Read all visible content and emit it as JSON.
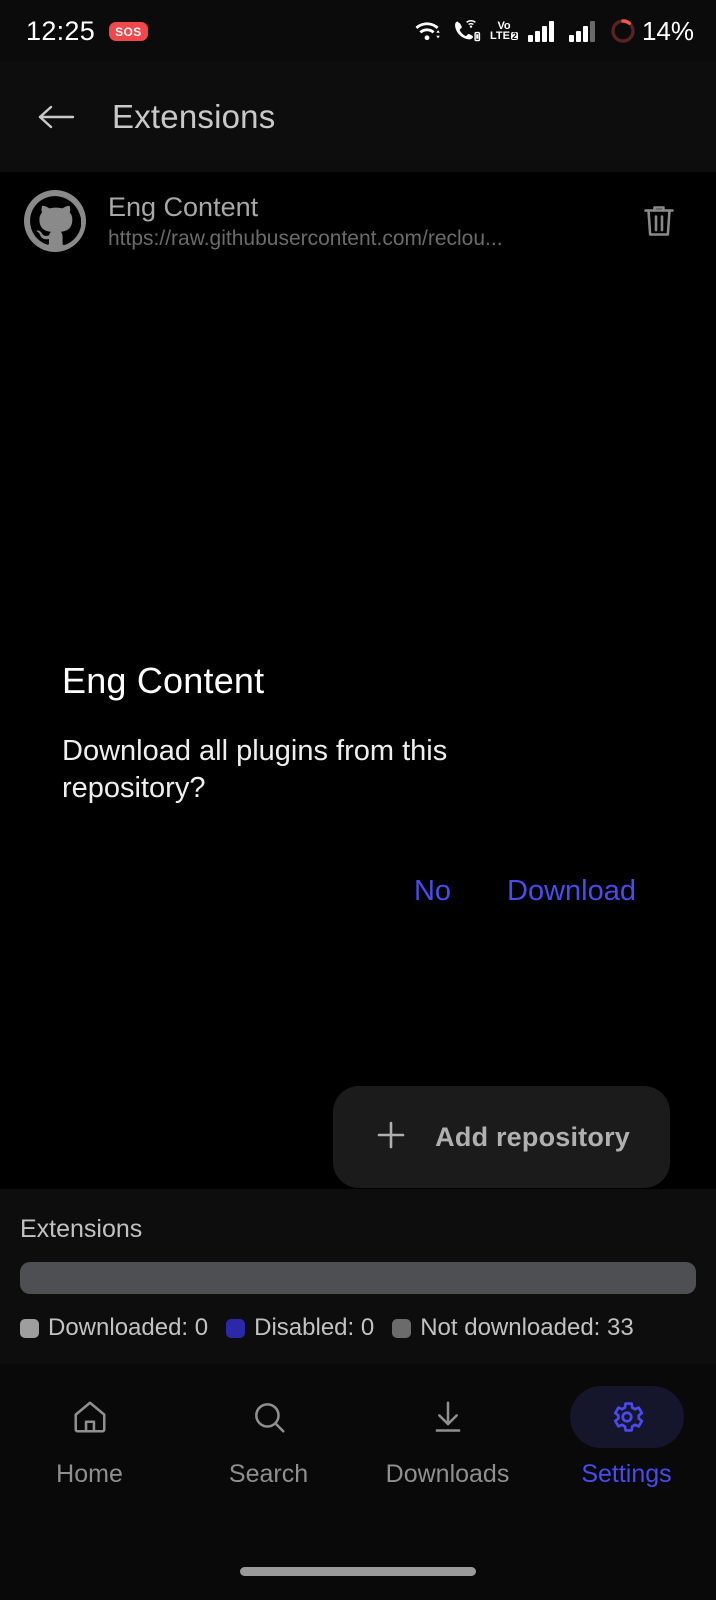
{
  "status_bar": {
    "time": "12:25",
    "sos_label": "SOS",
    "volte_top": "Vo",
    "volte_bottom": "LTE",
    "volte_sim": "2",
    "battery_percent": "14%",
    "icons": [
      "wifi-icon",
      "wifi-calling-icon",
      "volte-icon",
      "signal-bars-icon",
      "signal-bars-icon",
      "battery-ring-icon"
    ]
  },
  "app_bar": {
    "back_icon": "back-arrow-icon",
    "title": "Extensions"
  },
  "repository": {
    "avatar_icon": "github-icon",
    "name": "Eng Content",
    "url": "https://raw.githubusercontent.com/reclou...",
    "delete_icon": "trash-icon"
  },
  "dialog": {
    "title": "Eng Content",
    "message": "Download all plugins from this repository?",
    "negative_label": "No",
    "positive_label": "Download",
    "accent_color": "#4a4aee"
  },
  "fab": {
    "icon": "plus-icon",
    "label": "Add repository"
  },
  "stats": {
    "title": "Extensions",
    "legend": [
      {
        "label": "Downloaded: 0",
        "color": "#9e9e9e",
        "value": 0
      },
      {
        "label": "Disabled: 0",
        "color": "#2a2aa8",
        "value": 0
      },
      {
        "label": "Not downloaded: 33",
        "color": "#6b6b6b",
        "value": 33
      }
    ],
    "bar_color": "#4d4f53"
  },
  "bottom_nav": {
    "items": [
      {
        "label": "Home",
        "icon": "home-icon",
        "active": false
      },
      {
        "label": "Search",
        "icon": "search-icon",
        "active": false
      },
      {
        "label": "Downloads",
        "icon": "download-icon",
        "active": false
      },
      {
        "label": "Settings",
        "icon": "gear-icon",
        "active": true
      }
    ],
    "active_color": "#4a4aee"
  }
}
